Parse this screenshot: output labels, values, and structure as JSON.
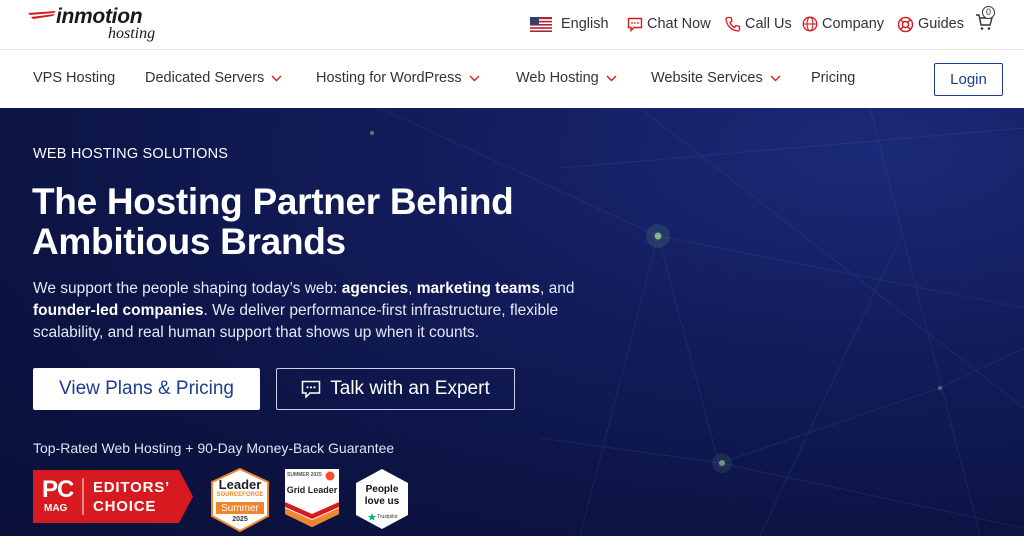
{
  "brand": {
    "logo_main": "inmotion",
    "logo_sub": "hosting"
  },
  "utility": {
    "language": "English",
    "chat": "Chat Now",
    "call": "Call Us",
    "company": "Company",
    "guides": "Guides",
    "cart_count": "0"
  },
  "nav": {
    "items": [
      {
        "label": "VPS Hosting",
        "dropdown": false
      },
      {
        "label": "Dedicated Servers",
        "dropdown": true
      },
      {
        "label": "Hosting for WordPress",
        "dropdown": true
      },
      {
        "label": "Web Hosting",
        "dropdown": true
      },
      {
        "label": "Website Services",
        "dropdown": true
      },
      {
        "label": "Pricing",
        "dropdown": false
      }
    ],
    "login": "Login"
  },
  "hero": {
    "eyebrow": "WEB HOSTING SOLUTIONS",
    "headline_line1": "The Hosting Partner Behind",
    "headline_line2": "Ambitious Brands",
    "desc_1": "We support the people shaping today’s web: ",
    "desc_b1": "agencies",
    "desc_2": ", ",
    "desc_b2": "marketing teams",
    "desc_3": ", and ",
    "desc_b3": "founder-led companies",
    "desc_4": ". We deliver performance-first infrastructure, flexible scalability, and real human support that shows up when it counts.",
    "primary_cta": "View Plans & Pricing",
    "secondary_cta": "Talk with an Expert",
    "guarantee": "Top-Rated Web Hosting + 90-Day Money-Back Guarantee"
  },
  "badges": {
    "pcmag_logo": "PC",
    "pcmag_sub": "MAG",
    "pcmag_line1": "EDITORS’",
    "pcmag_line2": "CHOICE",
    "sourceforge_title": "Leader",
    "sourceforge_brand": "SOURCEFORGE",
    "sourceforge_season": "Summer",
    "sourceforge_year": "2025",
    "g2_season": "SUMMER 2025",
    "g2_title": "Grid Leader",
    "trustpilot_line1": "People",
    "trustpilot_line2": "love us",
    "trustpilot_brand": "Trustpilot"
  },
  "colors": {
    "brand_blue": "#1c3d8f",
    "hero_bg": "#0f1850",
    "accent_red": "#d71920",
    "sourceforge_orange": "#f0852d",
    "trustpilot_green": "#00b67a"
  }
}
